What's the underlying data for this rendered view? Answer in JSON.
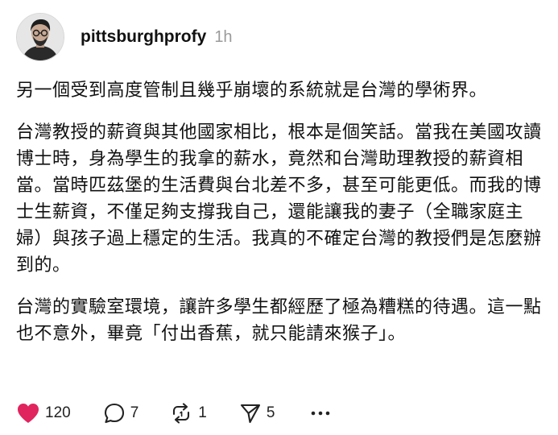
{
  "post": {
    "username": "pittsburghprofy",
    "time": "1h",
    "paragraphs": [
      "另一個受到高度管制且幾乎崩壞的系統就是台灣的學術界。",
      "台灣教授的薪資與其他國家相比，根本是個笑話。當我在美國攻讀博士時，身為學生的我拿的薪水，竟然和台灣助理教授的薪資相當。當時匹茲堡的生活費與台北差不多，甚至可能更低。而我的博士生薪資，不僅足夠支撐我自己，還能讓我的妻子（全職家庭主婦）與孩子過上穩定的生活。我真的不確定台灣的教授們是怎麼辦到的。",
      "台灣的實驗室環境，讓許多學生都經歷了極為糟糕的待遇。這一點也不意外，畢竟「付出香蕉，就只能請來猴子」。"
    ]
  },
  "actions": {
    "like_count": "120",
    "reply_count": "7",
    "repost_count": "1",
    "share_count": "5",
    "like_icon": "heart-filled-icon",
    "reply_icon": "speech-bubble-icon",
    "repost_icon": "repost-arrows-icon",
    "share_icon": "send-icon",
    "more_icon": "more-dots-icon"
  },
  "colors": {
    "like": "#e0245e",
    "text": "#111111",
    "muted": "#9a9a9a"
  }
}
